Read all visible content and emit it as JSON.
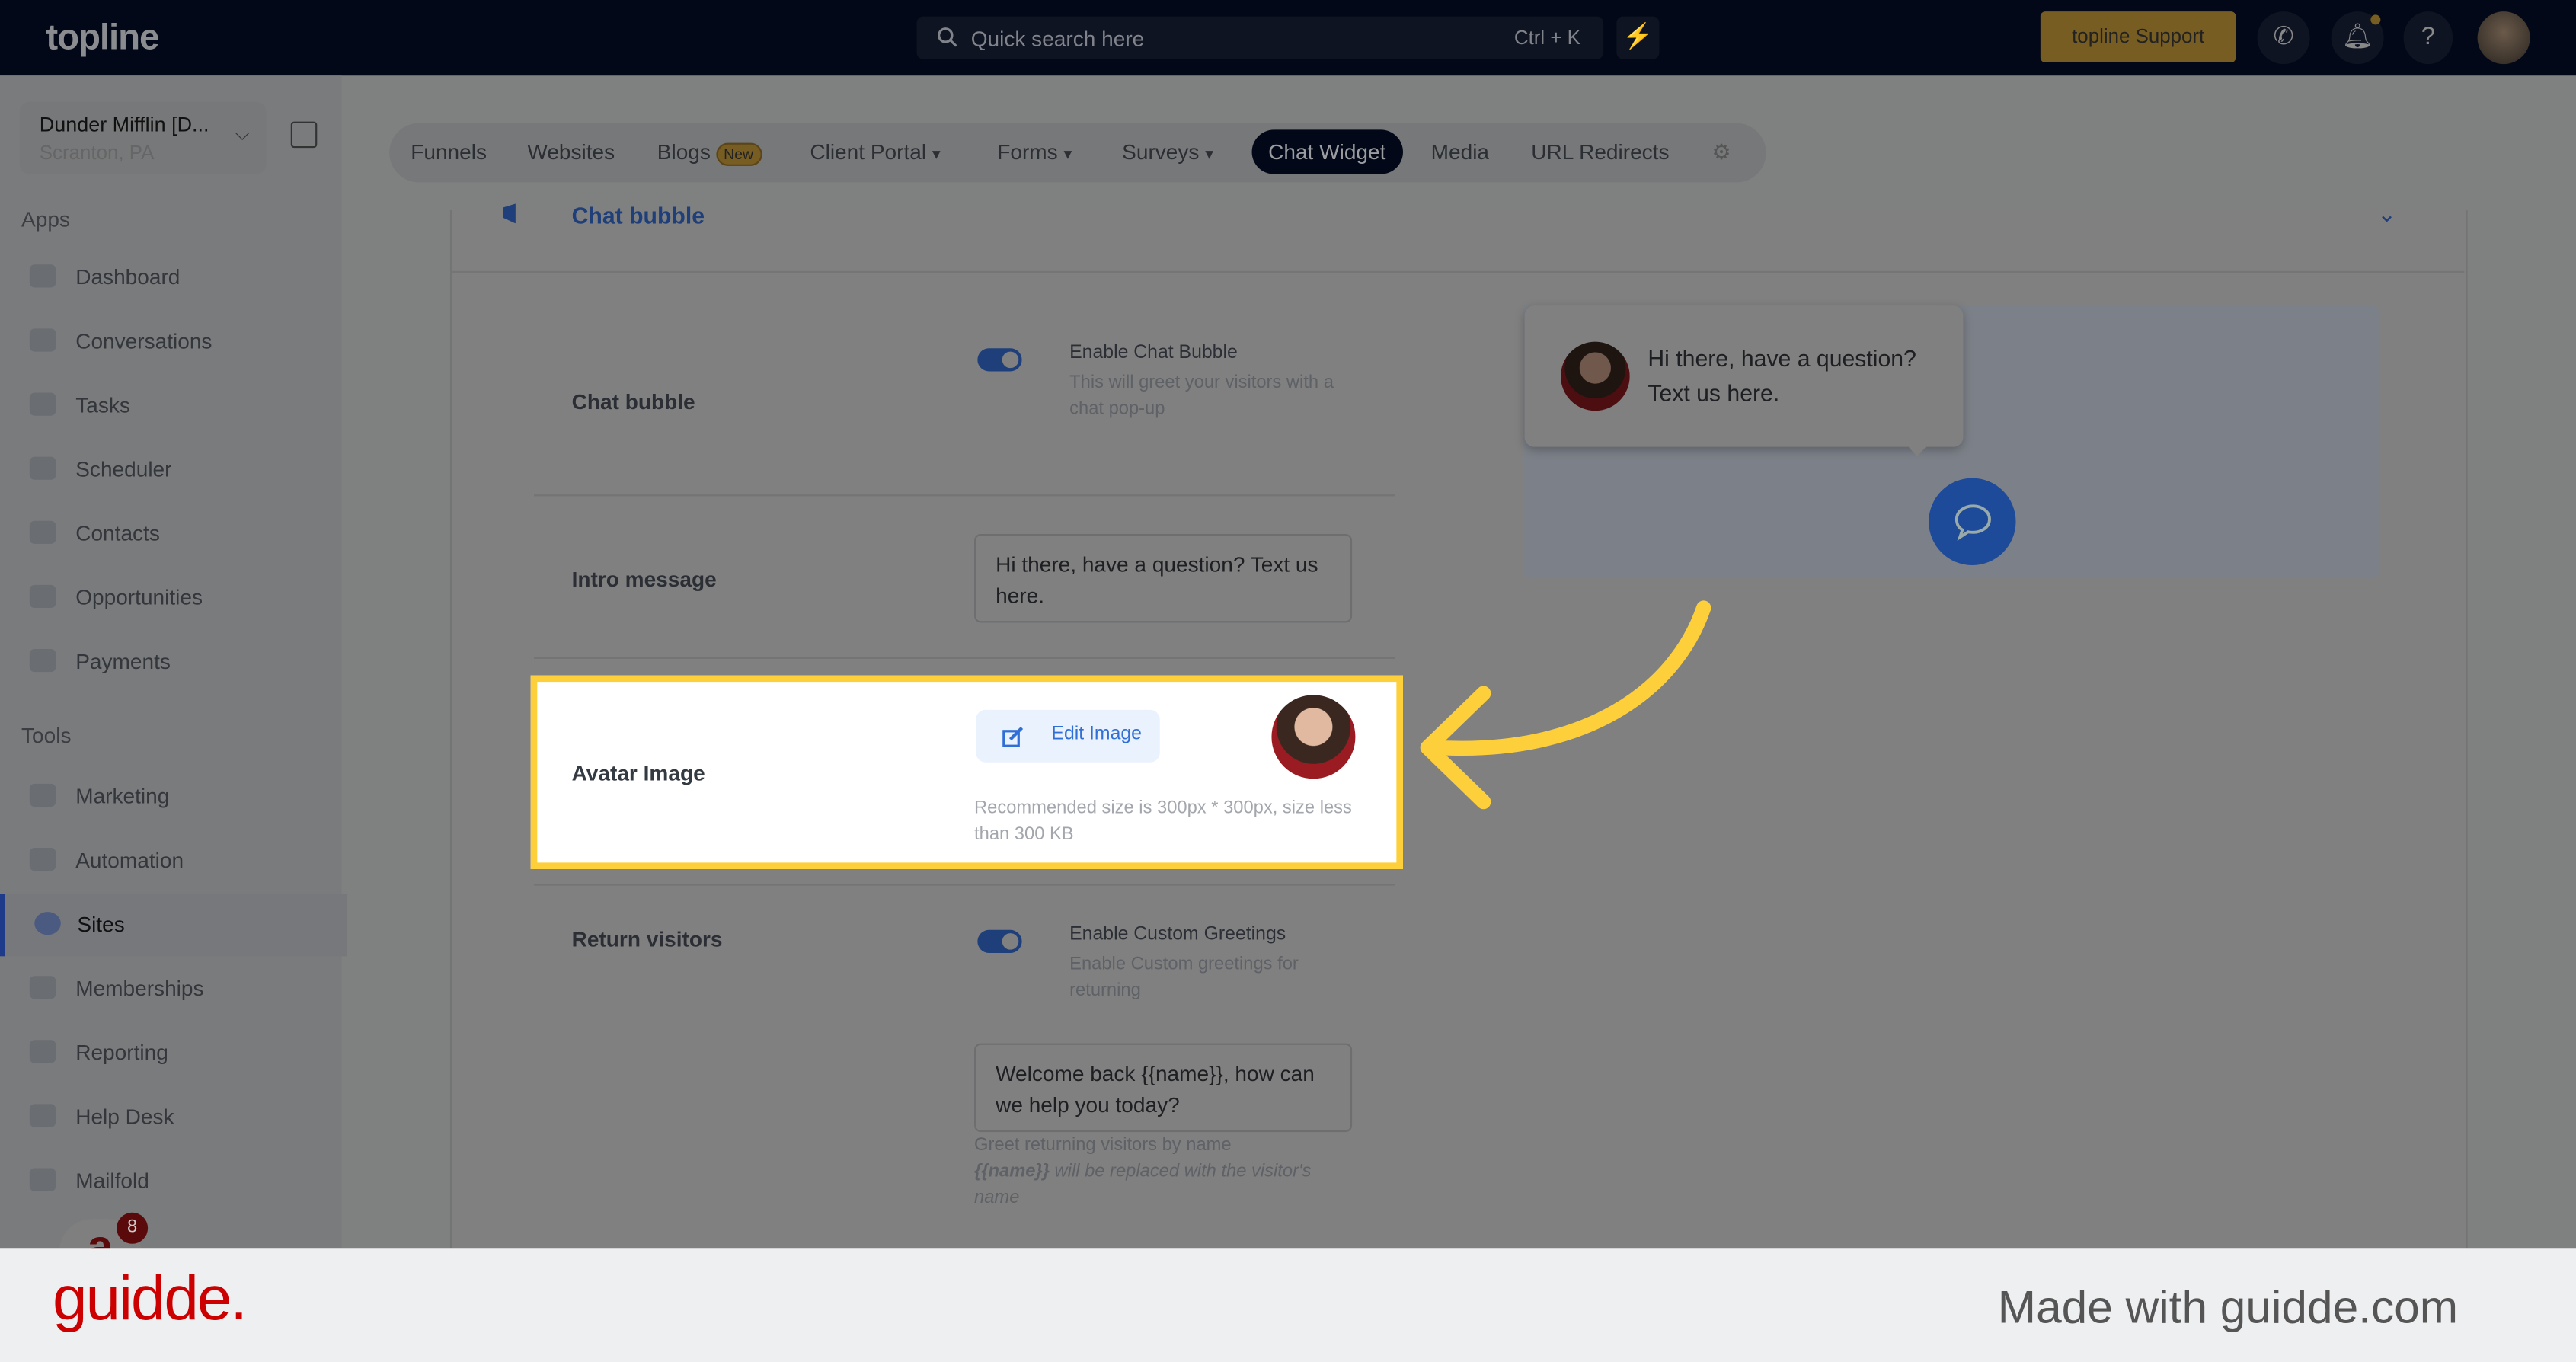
{
  "header": {
    "logo": "topline",
    "search_placeholder": "Quick search here",
    "search_shortcut": "Ctrl + K",
    "support_label": "topline Support",
    "icons": [
      "search-icon",
      "bolt-icon",
      "phone-icon",
      "bell-icon",
      "help-icon",
      "user-avatar"
    ]
  },
  "account": {
    "name": "Dunder Mifflin [D...",
    "location": "Scranton, PA"
  },
  "sidebar": {
    "apps_label": "Apps",
    "tools_label": "Tools",
    "apps": [
      {
        "label": "Dashboard"
      },
      {
        "label": "Conversations"
      },
      {
        "label": "Tasks"
      },
      {
        "label": "Scheduler"
      },
      {
        "label": "Contacts"
      },
      {
        "label": "Opportunities"
      },
      {
        "label": "Payments"
      }
    ],
    "tools": [
      {
        "label": "Marketing"
      },
      {
        "label": "Automation"
      },
      {
        "label": "Sites",
        "active": true
      },
      {
        "label": "Memberships"
      },
      {
        "label": "Reporting"
      },
      {
        "label": "Help Desk"
      },
      {
        "label": "Mailfold"
      }
    ],
    "notification_count": "8"
  },
  "tabs": [
    {
      "label": "Funnels"
    },
    {
      "label": "Websites"
    },
    {
      "label": "Blogs",
      "badge": "New"
    },
    {
      "label": "Client Portal"
    },
    {
      "label": "Forms"
    },
    {
      "label": "Surveys"
    },
    {
      "label": "Chat Widget",
      "active": true
    },
    {
      "label": "Media"
    },
    {
      "label": "URL Redirects"
    }
  ],
  "section": {
    "title": "Chat bubble",
    "chat_bubble": {
      "label": "Chat bubble",
      "toggle_on": true,
      "option": "Enable Chat Bubble",
      "desc": "This will greet your visitors with a chat pop-up"
    },
    "intro": {
      "label": "Intro message",
      "value": "Hi there, have a question? Text us here."
    },
    "avatar": {
      "label": "Avatar Image",
      "button": "Edit Image",
      "hint": "Recommended size is 300px * 300px, size less than 300 KB"
    },
    "return": {
      "label": "Return visitors",
      "toggle_on": true,
      "option": "Enable Custom Greetings",
      "desc": "Enable Custom greetings for returning",
      "value": "Welcome back {{name}}, how can we help you today?",
      "hint1": "Greet returning visitors by name",
      "hint_var": "{{name}}",
      "hint2": " will be replaced with the visitor's name"
    }
  },
  "preview": {
    "message": "Hi there, have a question? Text us here."
  },
  "footer": {
    "brand": "guidde.",
    "tagline": "Made with guidde.com"
  },
  "colors": {
    "highlight": "#fdd03b",
    "accent": "#2f6fd6",
    "brand_red": "#cc0000"
  }
}
